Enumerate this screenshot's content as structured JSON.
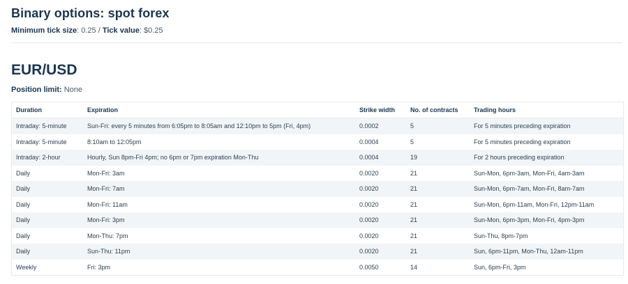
{
  "section": {
    "title": "Binary options: spot forex",
    "min_tick_label": "Minimum tick size",
    "min_tick_value": ": 0.25 / ",
    "tick_value_label": "Tick value",
    "tick_value_value": ": $0.25"
  },
  "pair": {
    "title": "EUR/USD",
    "position_limit_label": "Position limit:",
    "position_limit_value": " None"
  },
  "table": {
    "headers": [
      "Duration",
      "Expiration",
      "Strike width",
      "No. of contracts",
      "Trading hours"
    ],
    "rows": [
      [
        "Intraday: 5-minute",
        "Sun-Fri: every 5 minutes from 6:05pm to 8:05am and 12:10pm to 5pm (Fri, 4pm)",
        "0.0002",
        "5",
        "For 5 minutes preceding expiration"
      ],
      [
        "Intraday: 5-minute",
        "8:10am to 12:05pm",
        "0.0004",
        "5",
        "For 5 minutes preceding expiration"
      ],
      [
        "Intraday: 2-hour",
        "Hourly, Sun 8pm-Fri 4pm; no 6pm or 7pm expiration Mon-Thu",
        "0.0004",
        "19",
        "For 2 hours preceding expiration"
      ],
      [
        "Daily",
        "Mon-Fri: 3am",
        "0.0020",
        "21",
        "Sun-Mon, 6pm-3am, Mon-Fri, 4am-3am"
      ],
      [
        "Daily",
        "Mon-Fri: 7am",
        "0.0020",
        "21",
        "Sun-Mon, 6pm-7am, Mon-Fri, 8am-7am"
      ],
      [
        "Daily",
        "Mon-Fri: 11am",
        "0.0020",
        "21",
        "Sun-Mon, 6pm-11am, Mon-Fri, 12pm-11am"
      ],
      [
        "Daily",
        "Mon-Fri: 3pm",
        "0.0020",
        "21",
        "Sun-Mon, 6pm-3pm, Mon-Fri, 4pm-3pm"
      ],
      [
        "Daily",
        "Mon-Thu: 7pm",
        "0.0020",
        "21",
        "Sun-Thu, 8pm-7pm"
      ],
      [
        "Daily",
        "Sun-Thu: 11pm",
        "0.0020",
        "21",
        "Sun, 6pm-11pm, Mon-Thu, 12am-11pm"
      ],
      [
        "Weekly",
        "Fri: 3pm",
        "0.0050",
        "14",
        "Sun, 6pm-Fri, 3pm"
      ]
    ]
  }
}
